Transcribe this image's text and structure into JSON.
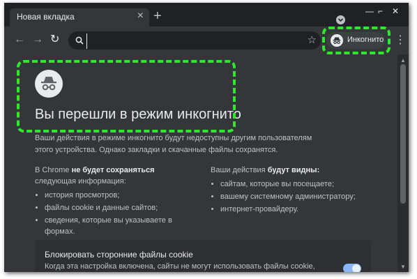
{
  "tab": {
    "title": "Новая вкладка",
    "close": "×",
    "new_tab": "+"
  },
  "window_controls": {
    "minimize": "—",
    "maximize": "⌐",
    "close": "✕"
  },
  "toolbar": {
    "back": "←",
    "forward": "→",
    "reload": "↻",
    "omnibox_value": "",
    "star": "☆",
    "incognito_label": "Инкогнито",
    "menu": "⋮"
  },
  "page": {
    "heading": "Вы перешли в режим инкогнито",
    "description": "Ваши действия в режиме инкогнито будут недоступны другим пользователям этого устройства. Однако закладки и скачанные файлы сохранятся.",
    "left_col": {
      "intro_prefix": "В Chrome",
      "intro_bold": "не будет сохраняться",
      "intro_suffix": "следующая информация:",
      "items": [
        "история просмотров;",
        "файлы cookie и данные сайтов;",
        "сведения, которые вы указываете в формах."
      ]
    },
    "right_col": {
      "intro_prefix": "Ваши действия",
      "intro_bold": "будут видны:",
      "items": [
        "сайтам, которые вы посещаете;",
        "вашему системному администратору;",
        "интернет-провайдеру."
      ]
    },
    "cookie": {
      "title": "Блокировать сторонние файлы cookie",
      "text": "Когда эта настройка включена, сайты не могут использовать файлы cookie,"
    }
  },
  "icons": {
    "incognito": "incognito-icon",
    "search": "search-icon",
    "star": "star-icon",
    "menu": "more-vertical-icon"
  },
  "colors": {
    "highlight": "#2ee82e",
    "toggle_on": "#8ab4f8",
    "page_bg": "#35363a",
    "tabstrip_bg": "#202124"
  }
}
